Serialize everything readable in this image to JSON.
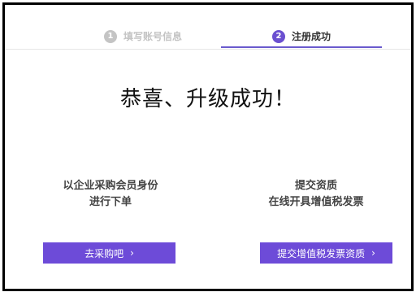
{
  "steps": [
    {
      "number": "1",
      "label": "填写账号信息",
      "active": false
    },
    {
      "number": "2",
      "label": "注册成功",
      "active": true
    }
  ],
  "success_title": "恭喜、升级成功！",
  "left_panel": {
    "line1": "以企业采购会员身份",
    "line2": "进行下单",
    "button_label": "去采购吧",
    "button_icon": "›"
  },
  "right_panel": {
    "line1": "提交资质",
    "line2": "在线开具增值税发票",
    "button_label": "提交增值税发票资质",
    "button_icon": "›"
  },
  "colors": {
    "accent": "#6d4bd8",
    "inactive_step": "#c4c4c4"
  }
}
